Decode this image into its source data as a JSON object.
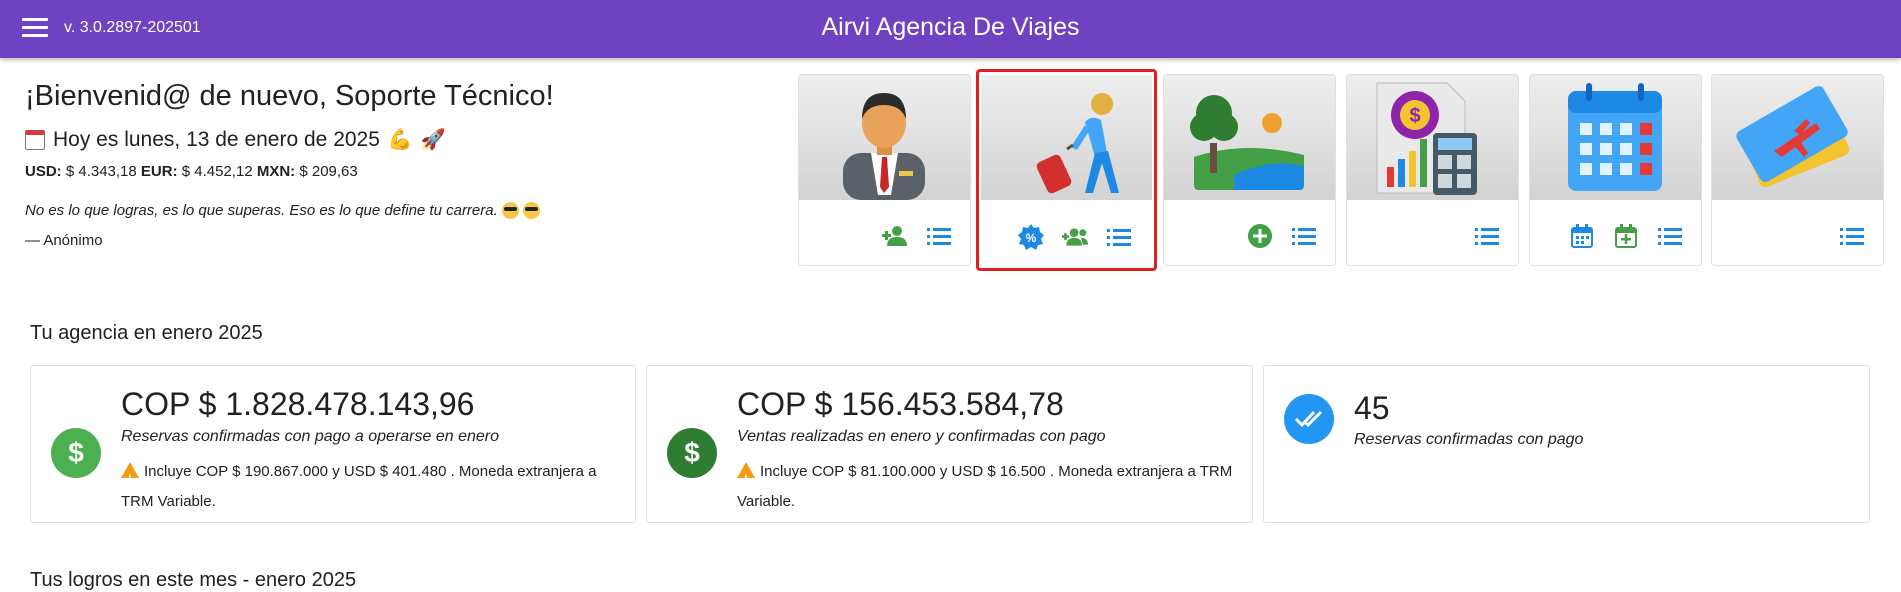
{
  "header": {
    "version": "v. 3.0.2897-202501",
    "title": "Airvi Agencia De Viajes"
  },
  "welcome": {
    "greeting": "¡Bienvenid@ de nuevo, Soporte Técnico!",
    "date": "Hoy es lunes, 13 de enero de 2025",
    "rates": {
      "usd_label": "USD:",
      "usd_value": "$ 4.343,18",
      "eur_label": "EUR:",
      "eur_value": "$ 4.452,12",
      "mxn_label": "MXN:",
      "mxn_value": "$ 209,63"
    },
    "quote": "No es lo que logras, es lo que superas. Eso es lo que define tu carrera.",
    "author": "— Anónimo"
  },
  "modules": [
    {
      "icon": "agent-icon",
      "actions": [
        "add-user-icon",
        "list-icon"
      ]
    },
    {
      "icon": "traveler-icon",
      "actions": [
        "discount-badge-icon",
        "group-add-icon",
        "list-icon"
      ],
      "selected": true
    },
    {
      "icon": "landscape-icon",
      "actions": [
        "add-circle-icon",
        "list-icon"
      ]
    },
    {
      "icon": "accounting-icon",
      "actions": [
        "list-icon"
      ]
    },
    {
      "icon": "calendar-icon",
      "actions": [
        "calendar-icon",
        "calendar-add-icon",
        "list-icon"
      ]
    },
    {
      "icon": "ticket-icon",
      "actions": [
        "list-icon"
      ]
    }
  ],
  "agency": {
    "section_title": "Tu agencia en enero 2025",
    "cards": [
      {
        "value": "COP $ 1.828.478.143,96",
        "description": "Reservas confirmadas con pago a operarse en enero",
        "note": "Incluye COP $ 190.867.000 y USD $ 401.480 . Moneda extranjera a TRM Variable.",
        "icon_color": "#4caf50"
      },
      {
        "value": "COP $ 156.453.584,78",
        "description": "Ventas realizadas en enero y confirmadas con pago",
        "note": "Incluye COP $ 81.100.000 y USD $ 16.500 . Moneda extranjera a TRM Variable.",
        "icon_color": "#2e7d32"
      },
      {
        "value": "45",
        "description": "Reservas confirmadas con pago",
        "note": "",
        "icon_color": "#2196f3"
      }
    ]
  },
  "achievements": {
    "section_title": "Tus logros en este mes - enero 2025"
  },
  "colors": {
    "topbar": "#6f42c1",
    "action_green": "#43a047",
    "action_blue": "#1e88e5",
    "highlight": "#e02020"
  }
}
